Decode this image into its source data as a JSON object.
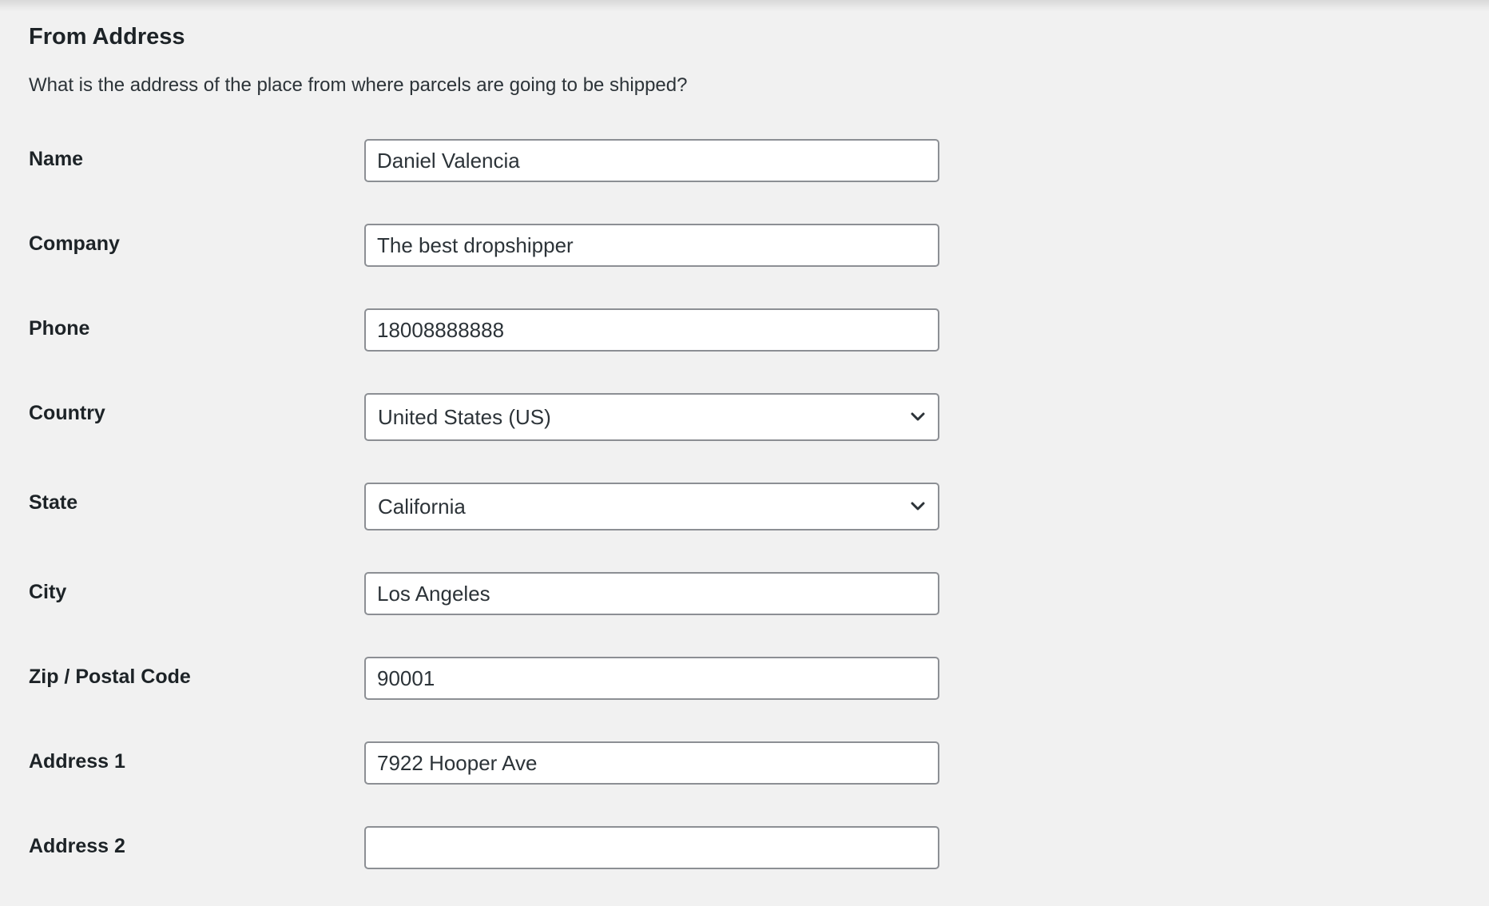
{
  "section": {
    "title": "From Address",
    "description": "What is the address of the place from where parcels are going to be shipped?"
  },
  "fields": {
    "name": {
      "label": "Name",
      "value": "Daniel Valencia"
    },
    "company": {
      "label": "Company",
      "value": "The best dropshipper"
    },
    "phone": {
      "label": "Phone",
      "value": "18008888888"
    },
    "country": {
      "label": "Country",
      "value": "United States (US)",
      "icon": "chevron-down-icon"
    },
    "state": {
      "label": "State",
      "value": "California",
      "icon": "chevron-down-icon"
    },
    "city": {
      "label": "City",
      "value": "Los Angeles"
    },
    "zip": {
      "label": "Zip / Postal Code",
      "value": "90001"
    },
    "address1": {
      "label": "Address 1",
      "value": "7922 Hooper Ave"
    },
    "address2": {
      "label": "Address 2",
      "value": ""
    }
  }
}
